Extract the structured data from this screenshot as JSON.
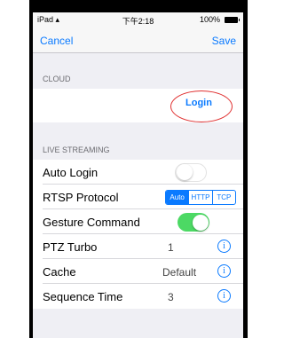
{
  "status_bar": {
    "carrier": "iPad ▴",
    "time": "下午2:18",
    "battery": "100%"
  },
  "nav": {
    "cancel": "Cancel",
    "save": "Save"
  },
  "cloud": {
    "header": "CLOUD",
    "login": "Login"
  },
  "live": {
    "header": "LIVE STREAMING",
    "auto_login": {
      "label": "Auto Login",
      "on": false
    },
    "rtsp": {
      "label": "RTSP Protocol",
      "options": [
        "Auto",
        "HTTP",
        "TCP"
      ],
      "selected": "Auto"
    },
    "gesture": {
      "label": "Gesture Command",
      "on": true
    },
    "ptz": {
      "label": "PTZ Turbo",
      "value": "1"
    },
    "cache": {
      "label": "Cache",
      "value": "Default"
    },
    "sequence": {
      "label": "Sequence Time",
      "value": "3"
    }
  },
  "colors": {
    "accent": "#0a7aff",
    "toggle_on": "#4cd964",
    "highlight": "#e03030"
  }
}
